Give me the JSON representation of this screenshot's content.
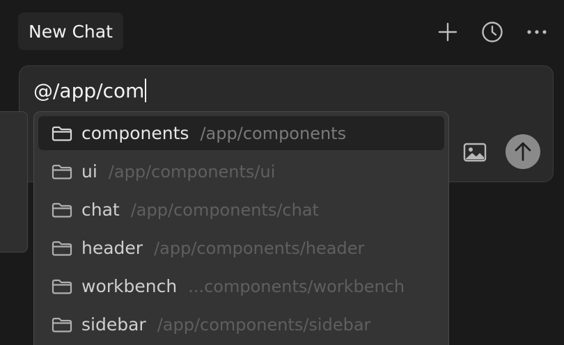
{
  "header": {
    "title": "New Chat",
    "actions": [
      {
        "name": "new-chat-button",
        "icon": "plus-icon"
      },
      {
        "name": "history-button",
        "icon": "clock-icon"
      },
      {
        "name": "more-options-button",
        "icon": "more-horizontal-icon"
      }
    ]
  },
  "composer": {
    "input_value": "@/app/com",
    "image_button_icon": "image-icon",
    "send_button_icon": "arrow-up-icon"
  },
  "mention_menu": {
    "selected_index": 0,
    "items": [
      {
        "name": "components",
        "path": "/app/components",
        "icon": "folder-icon"
      },
      {
        "name": "ui",
        "path": "/app/components/ui",
        "icon": "folder-icon"
      },
      {
        "name": "chat",
        "path": "/app/components/chat",
        "icon": "folder-icon"
      },
      {
        "name": "header",
        "path": "/app/components/header",
        "icon": "folder-icon"
      },
      {
        "name": "workbench",
        "path": "...components/workbench",
        "icon": "folder-icon"
      },
      {
        "name": "sidebar",
        "path": "/app/components/sidebar",
        "icon": "folder-icon"
      }
    ]
  },
  "colors": {
    "background": "#1a1a1a",
    "composer_bg": "#2a2a2a",
    "menu_bg": "#343434",
    "selected_bg": "#222222",
    "send_button": "#8a8a8a"
  }
}
